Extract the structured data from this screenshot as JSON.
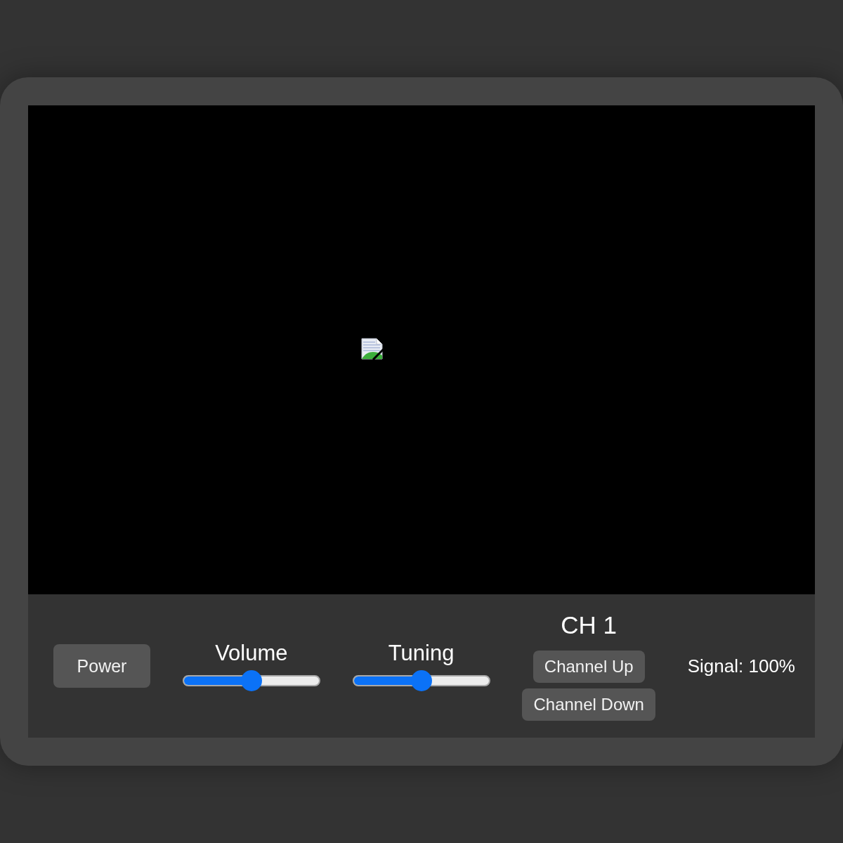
{
  "power_button": {
    "label": "Power"
  },
  "sliders": [
    {
      "label": "Volume",
      "level": 0.5
    },
    {
      "label": "Tuning",
      "level": 0.5
    }
  ],
  "channel": {
    "display": "CH 1",
    "buttons": [
      "Channel Up",
      "Channel Down"
    ]
  },
  "signal": "Signal: 100%"
}
